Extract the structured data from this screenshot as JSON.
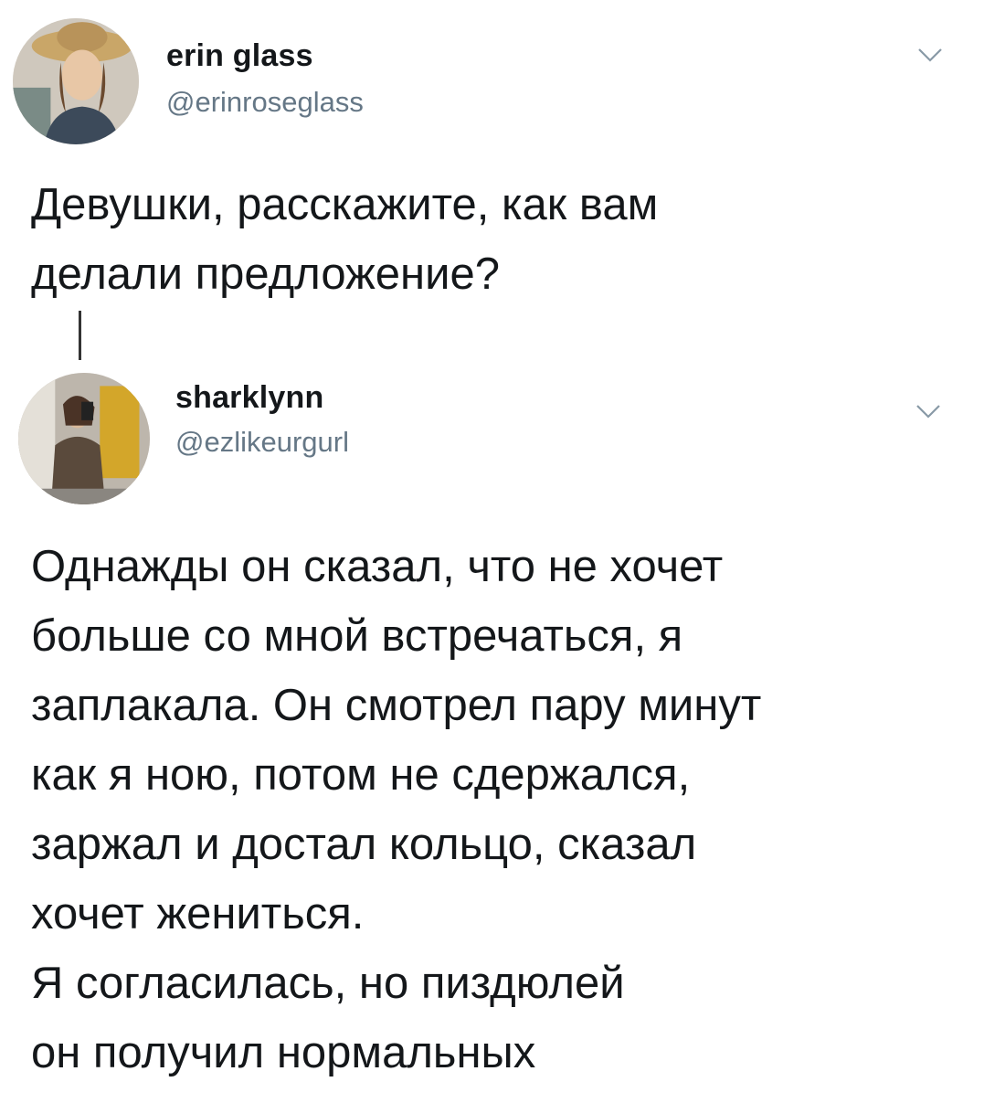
{
  "tweets": [
    {
      "display_name": "erin glass",
      "handle": "@erinroseglass",
      "text": "Девушки, расскажите, как вам\nделали предложение?"
    },
    {
      "display_name": "sharklynn",
      "handle": "@ezlikeurgurl",
      "text": "Однажды он сказал, что не хочет\nбольше со мной встречаться, я\nзаплакала. Он смотрел пару минут\nкак я ною, потом не сдержался,\nзаржал и достал кольцо, сказал\nхочет жениться.\nЯ согласилась, но пиздюлей\nон получил нормальных"
    }
  ],
  "icons": {
    "menu_icon": "chevron-down-icon"
  },
  "colors": {
    "text_primary": "#14171a",
    "text_secondary": "#657786",
    "chevron": "#8899a6"
  }
}
